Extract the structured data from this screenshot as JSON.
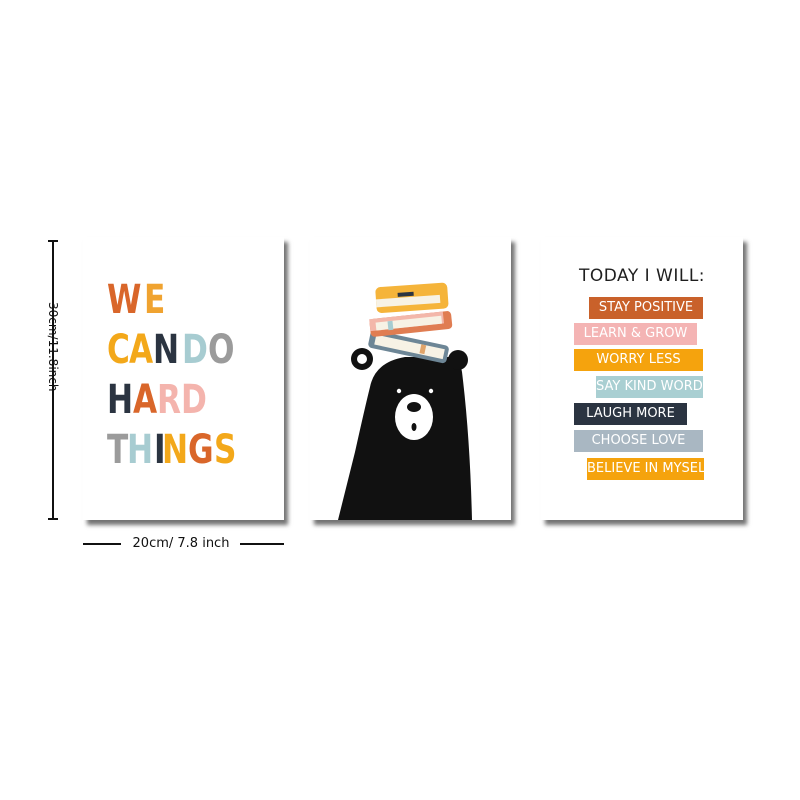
{
  "dimensions": {
    "height_label": "30cm/11.8inch",
    "width_label": "20cm/ 7.8 inch"
  },
  "poster_left": {
    "lines": [
      {
        "text": "WE",
        "letters": [
          {
            "c": "W",
            "color": "#d9662a"
          },
          {
            "c": "E",
            "color": "#f0a330"
          }
        ]
      },
      {
        "text": "CAN DO",
        "letters": [
          {
            "c": "C",
            "color": "#f3a81a"
          },
          {
            "c": "A",
            "color": "#f3a81a"
          },
          {
            "c": "N",
            "color": "#2b3441"
          },
          {
            "c": " ",
            "color": "#fff"
          },
          {
            "c": "D",
            "color": "#a7ccd1"
          },
          {
            "c": "O",
            "color": "#9b9b9b"
          }
        ]
      },
      {
        "text": "HARD",
        "letters": [
          {
            "c": "H",
            "color": "#2b3441"
          },
          {
            "c": "A",
            "color": "#d9662a"
          },
          {
            "c": "R",
            "color": "#f4b4ad"
          },
          {
            "c": "D",
            "color": "#f4b4ad"
          }
        ]
      },
      {
        "text": "THINGS",
        "letters": [
          {
            "c": "T",
            "color": "#9b9b9b"
          },
          {
            "c": "H",
            "color": "#a7ccd1"
          },
          {
            "c": "I",
            "color": "#2b3441"
          },
          {
            "c": "N",
            "color": "#f3a81a"
          },
          {
            "c": "G",
            "color": "#d9662a"
          },
          {
            "c": "S",
            "color": "#f3a81a"
          }
        ]
      }
    ]
  },
  "poster_middle": {
    "illustration": "bear-with-books"
  },
  "poster_right": {
    "title": "TODAY I WILL:",
    "items": [
      {
        "label": "STAY POSITIVE",
        "color": "#c9612a"
      },
      {
        "label": "LEARN & GROW",
        "color": "#f4b4b4"
      },
      {
        "label": "WORRY LESS",
        "color": "#f5a30d"
      },
      {
        "label": "SAY KIND WORDS",
        "color": "#a9cfd2"
      },
      {
        "label": "LAUGH MORE",
        "color": "#2b3441"
      },
      {
        "label": "CHOOSE LOVE",
        "color": "#a9b7c2"
      },
      {
        "label": "BELIEVE IN MYSELF",
        "color": "#f5a30d"
      }
    ]
  }
}
